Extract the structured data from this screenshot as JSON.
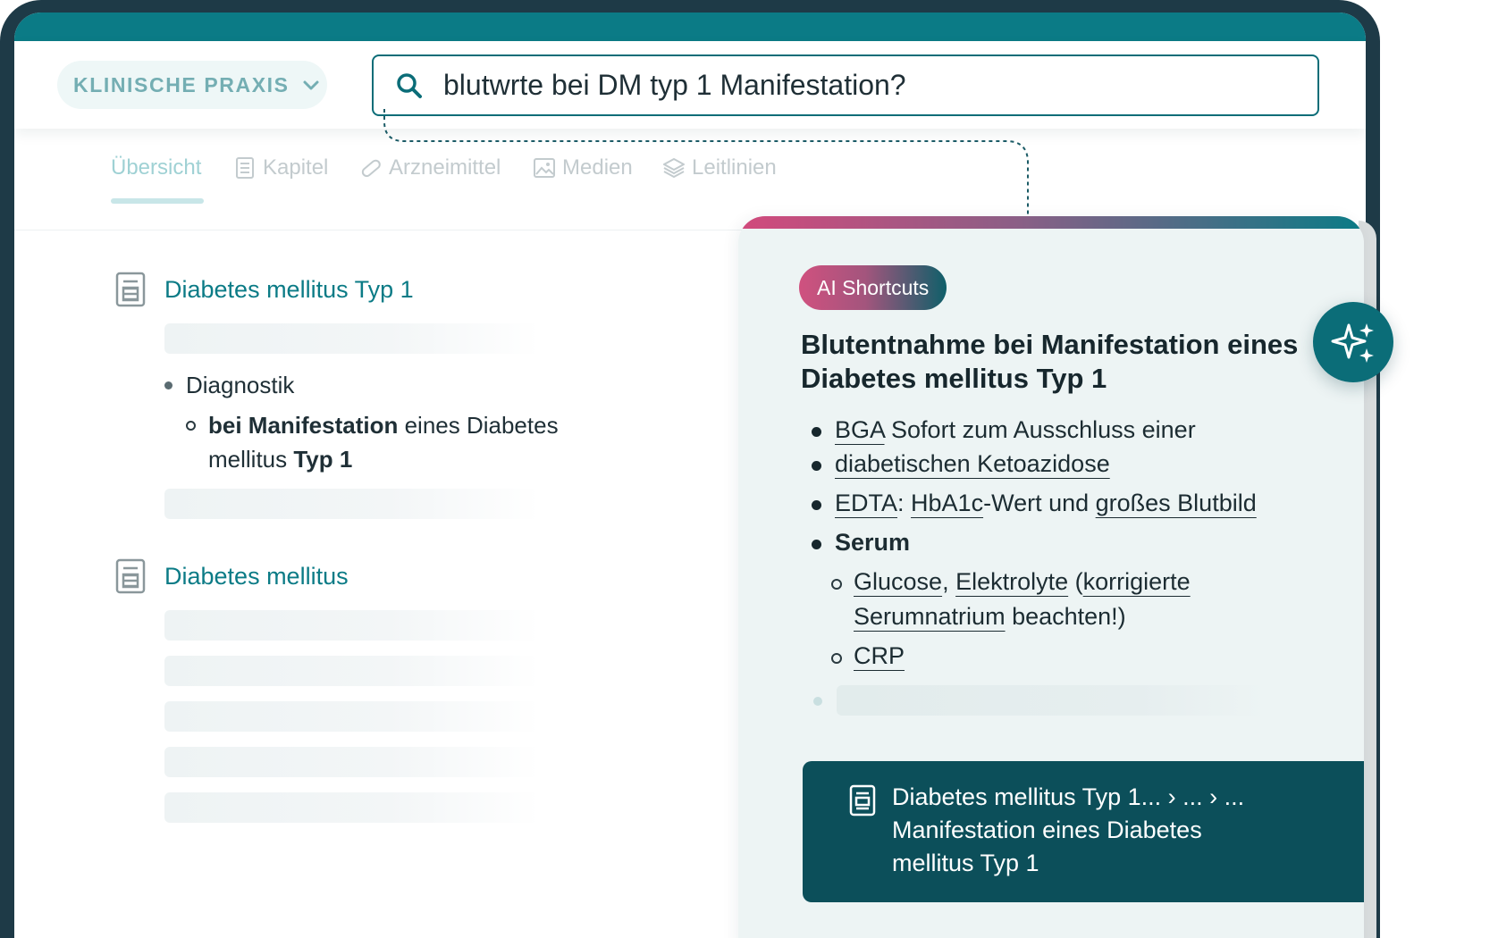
{
  "header": {
    "praxis_label": "KLINISCHE PRAXIS",
    "search_value": "blutwrte bei DM typ 1 Manifestation?"
  },
  "tabs": [
    {
      "label": "Übersicht",
      "icon": "none",
      "active": true
    },
    {
      "label": "Kapitel",
      "icon": "chapter-icon",
      "active": false
    },
    {
      "label": "Arzneimittel",
      "icon": "pill-icon",
      "active": false
    },
    {
      "label": "Medien",
      "icon": "image-icon",
      "active": false
    },
    {
      "label": "Leitlinien",
      "icon": "layers-icon",
      "active": false
    }
  ],
  "results": [
    {
      "title": "Diabetes mellitus Typ 1"
    },
    {
      "title": "Diabetes mellitus"
    }
  ],
  "snippet": {
    "bullet": "Diagnostik",
    "sub_bold_1": "bei Manifestation",
    "sub_text_1": " eines Diabetes",
    "sub_text_2": "mellitus ",
    "sub_bold_2": "Typ 1"
  },
  "ai": {
    "pill": "AI Shortcuts",
    "title": "Blutentnahme bei Manifestation eines Diabetes mellitus Typ 1",
    "items": {
      "bga_link": "BGA",
      "bga_text": " Sofort zum Ausschluss einer",
      "keto_link": "diabetischen Ketoazidose",
      "edta_link": "EDTA",
      "edta_colon": ": ",
      "hba1c_link": "HbA1c",
      "edta_mid": "-Wert und ",
      "blutbild_link": "großes Blutbild",
      "serum": "Serum",
      "glucose_link": "Glucose",
      "comma": ", ",
      "elektrolyte_link": "Elektrolyte",
      "korr_open": " (",
      "korr_link": "korrigierte ",
      "serumnatrium_link": "Serumnatrium",
      "beachten": " beachten!)",
      "crp_link": "CRP"
    },
    "reference": {
      "line1": "Diabetes mellitus Typ 1... › ... › ...",
      "line2": "Manifestation eines Diabetes",
      "line3": "mellitus Typ 1"
    }
  },
  "colors": {
    "brand_teal": "#0b7b86",
    "dark_teal": "#0c4f5a",
    "accent_pink": "#d24a7c"
  }
}
